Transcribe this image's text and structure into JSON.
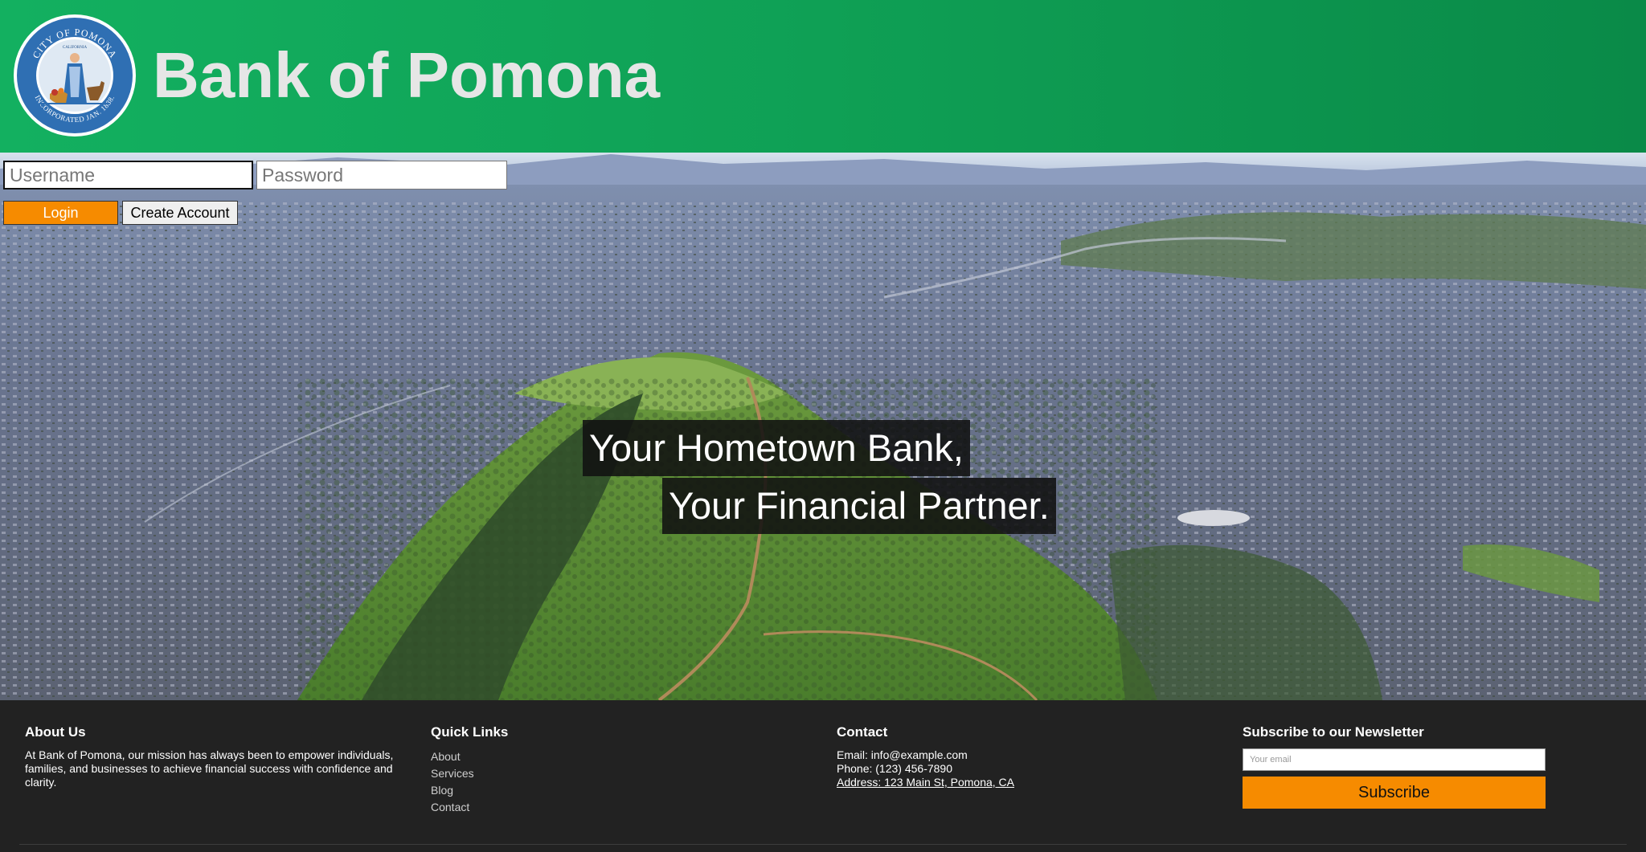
{
  "header": {
    "title": "Bank of Pomona",
    "seal": {
      "label": "city-of-pomona-seal-icon",
      "text_top": "CITY OF POMONA",
      "text_center": "CALIFORNIA",
      "text_bottom": "INCORPORATED JAN. 1888."
    }
  },
  "login": {
    "username_placeholder": "Username",
    "password_placeholder": "Password",
    "login_label": "Login",
    "create_account_label": "Create Account"
  },
  "hero": {
    "line1": "Your Hometown Bank,",
    "line2": "Your Financial Partner."
  },
  "footer": {
    "about": {
      "title": "About Us",
      "text": "At Bank of Pomona, our mission has always been to empower individuals, families, and businesses to achieve financial success with confidence and clarity."
    },
    "quick_links": {
      "title": "Quick Links",
      "items": [
        "About",
        "Services",
        "Blog",
        "Contact"
      ]
    },
    "contact": {
      "title": "Contact",
      "email": "Email: info@example.com",
      "phone": "Phone: (123) 456-7890",
      "address": "Address: 123 Main St, Pomona, CA"
    },
    "newsletter": {
      "title": "Subscribe to our Newsletter",
      "email_placeholder": "Your email",
      "subscribe_label": "Subscribe"
    }
  },
  "colors": {
    "header_green": "#0fa055",
    "accent_orange": "#f68b00",
    "footer_bg": "#222222"
  }
}
